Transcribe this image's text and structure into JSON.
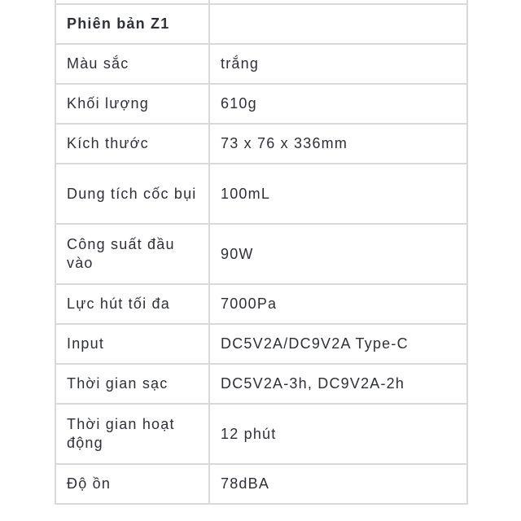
{
  "table": {
    "rows": [
      {
        "label": "",
        "value": ""
      },
      {
        "label": "Phiên bản Z1",
        "value": ""
      },
      {
        "label": "Màu sắc",
        "value": "trắng"
      },
      {
        "label": "Khối lượng",
        "value": "610g"
      },
      {
        "label": "Kích thước",
        "value": "73 x 76 x 336mm"
      },
      {
        "label": "Dung tích cốc bụi",
        "value": "100mL"
      },
      {
        "label": "Công suất đầu vào",
        "value": "90W"
      },
      {
        "label": "Lực hút tối đa",
        "value": "7000Pa"
      },
      {
        "label": "Input",
        "value": "DC5V2A/DC9V2A Type-C"
      },
      {
        "label": "Thời gian sạc",
        "value": "DC5V2A-3h, DC9V2A-2h"
      },
      {
        "label": "Thời gian hoạt động",
        "value": "12 phút"
      },
      {
        "label": "Độ ồn",
        "value": "78dBA"
      }
    ]
  }
}
